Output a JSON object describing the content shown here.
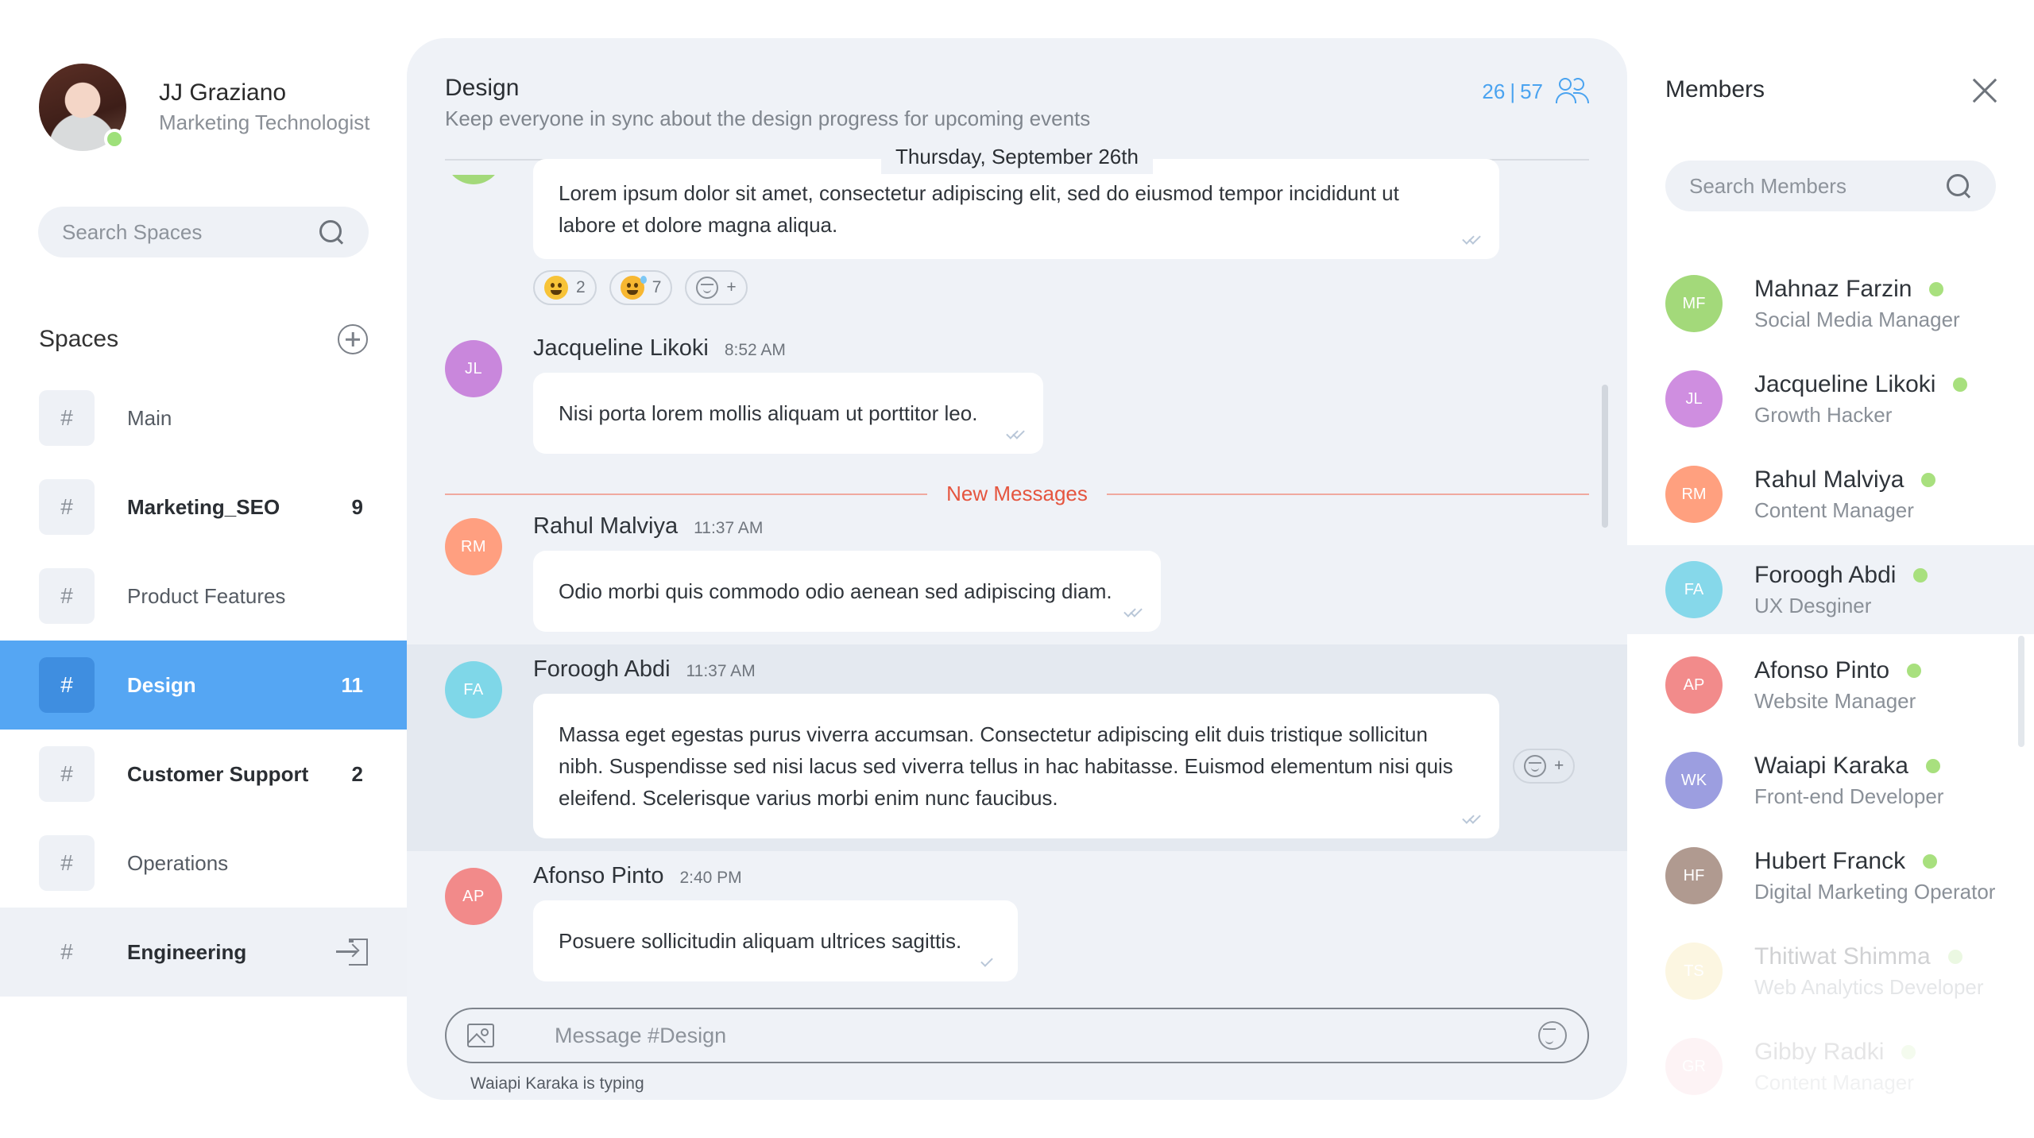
{
  "profile": {
    "name": "JJ Graziano",
    "role": "Marketing Technologist",
    "status": "online"
  },
  "spaces_search": {
    "placeholder": "Search Spaces"
  },
  "spaces_header": {
    "title": "Spaces"
  },
  "spaces": [
    {
      "hash": "#",
      "label": "Main",
      "count": "",
      "bold": false,
      "state": "normal"
    },
    {
      "hash": "#",
      "label": "Marketing_SEO",
      "count": "9",
      "bold": true,
      "state": "normal"
    },
    {
      "hash": "#",
      "label": "Product Features",
      "count": "",
      "bold": false,
      "state": "normal"
    },
    {
      "hash": "#",
      "label": "Design",
      "count": "11",
      "bold": true,
      "state": "active"
    },
    {
      "hash": "#",
      "label": "Customer Support",
      "count": "2",
      "bold": true,
      "state": "normal"
    },
    {
      "hash": "#",
      "label": "Operations",
      "count": "",
      "bold": false,
      "state": "normal"
    },
    {
      "hash": "#",
      "label": "Engineering",
      "count": "",
      "bold": true,
      "state": "join"
    }
  ],
  "chat": {
    "title": "Design",
    "description": "Keep everyone in sync about the design progress for upcoming events",
    "online_count": "26",
    "separator": "|",
    "total_count": "57",
    "date_divider": "Thursday, September 26th",
    "new_messages_label": "New Messages",
    "composer_placeholder": "Message #Design",
    "typing_indicator": "Waiapi Karaka is typing"
  },
  "messages": [
    {
      "text": "Lorem ipsum dolor sit amet, consectetur adipiscing elit, sed do eiusmod tempor incididunt ut labore et dolore magna aliqua.",
      "reactions": [
        {
          "emoji": "grinning-face",
          "count": "2"
        },
        {
          "emoji": "sweat-smile-face",
          "count": "7"
        }
      ],
      "add_reaction": "+"
    },
    {
      "initials": "JL",
      "name": "Jacqueline Likoki",
      "time": "8:52 AM",
      "text": "Nisi porta lorem mollis aliquam ut porttitor leo.",
      "color": "#c987dc"
    },
    {
      "initials": "RM",
      "name": "Rahul Malviya",
      "time": "11:37 AM",
      "text": "Odio morbi quis commodo odio aenean sed adipiscing diam.",
      "color": "#ff9f80"
    },
    {
      "initials": "FA",
      "name": "Foroogh Abdi",
      "time": "11:37 AM",
      "text": "Massa eget egestas purus viverra accumsan. Consectetur adipiscing elit duis tristique sollicitun nibh. Suspendisse sed nisi lacus sed viverra tellus in hac habitasse. Euismod elementum nisi quis eleifend. Scelerisque varius morbi enim nunc faucibus.",
      "color": "#7fd7e8",
      "add_reaction": "+"
    },
    {
      "initials": "AP",
      "name": "Afonso Pinto",
      "time": "2:40 PM",
      "text": "Posuere sollicitudin aliquam ultrices sagittis.",
      "color": "#f28a8a"
    }
  ],
  "members_panel": {
    "title": "Members",
    "search_placeholder": "Search Members"
  },
  "members": [
    {
      "initials": "MF",
      "name": "Mahnaz Farzin",
      "role": "Social Media Manager",
      "color": "#a3d97a",
      "online": true
    },
    {
      "initials": "JL",
      "name": "Jacqueline Likoki",
      "role": "Growth Hacker",
      "color": "#cf8ee0",
      "online": true
    },
    {
      "initials": "RM",
      "name": "Rahul Malviya",
      "role": "Content Manager",
      "color": "#ffa07f",
      "online": true
    },
    {
      "initials": "FA",
      "name": "Foroogh Abdi",
      "role": "UX Desginer",
      "color": "#86d8ea",
      "online": true
    },
    {
      "initials": "AP",
      "name": "Afonso Pinto",
      "role": "Website Manager",
      "color": "#f28b8b",
      "online": true
    },
    {
      "initials": "WK",
      "name": "Waiapi Karaka",
      "role": "Front-end Developer",
      "color": "#9c9ee0",
      "online": true
    },
    {
      "initials": "HF",
      "name": "Hubert Franck",
      "role": "Digital Marketing Operator",
      "color": "#b09a90",
      "online": true
    },
    {
      "initials": "TS",
      "name": "Thitiwat Shimma",
      "role": "Web Analytics Developer",
      "color": "#f5d97a",
      "online": true
    },
    {
      "initials": "GR",
      "name": "Gibby Radki",
      "role": "Content Manager",
      "color": "#f5a3b5",
      "online": true
    }
  ]
}
